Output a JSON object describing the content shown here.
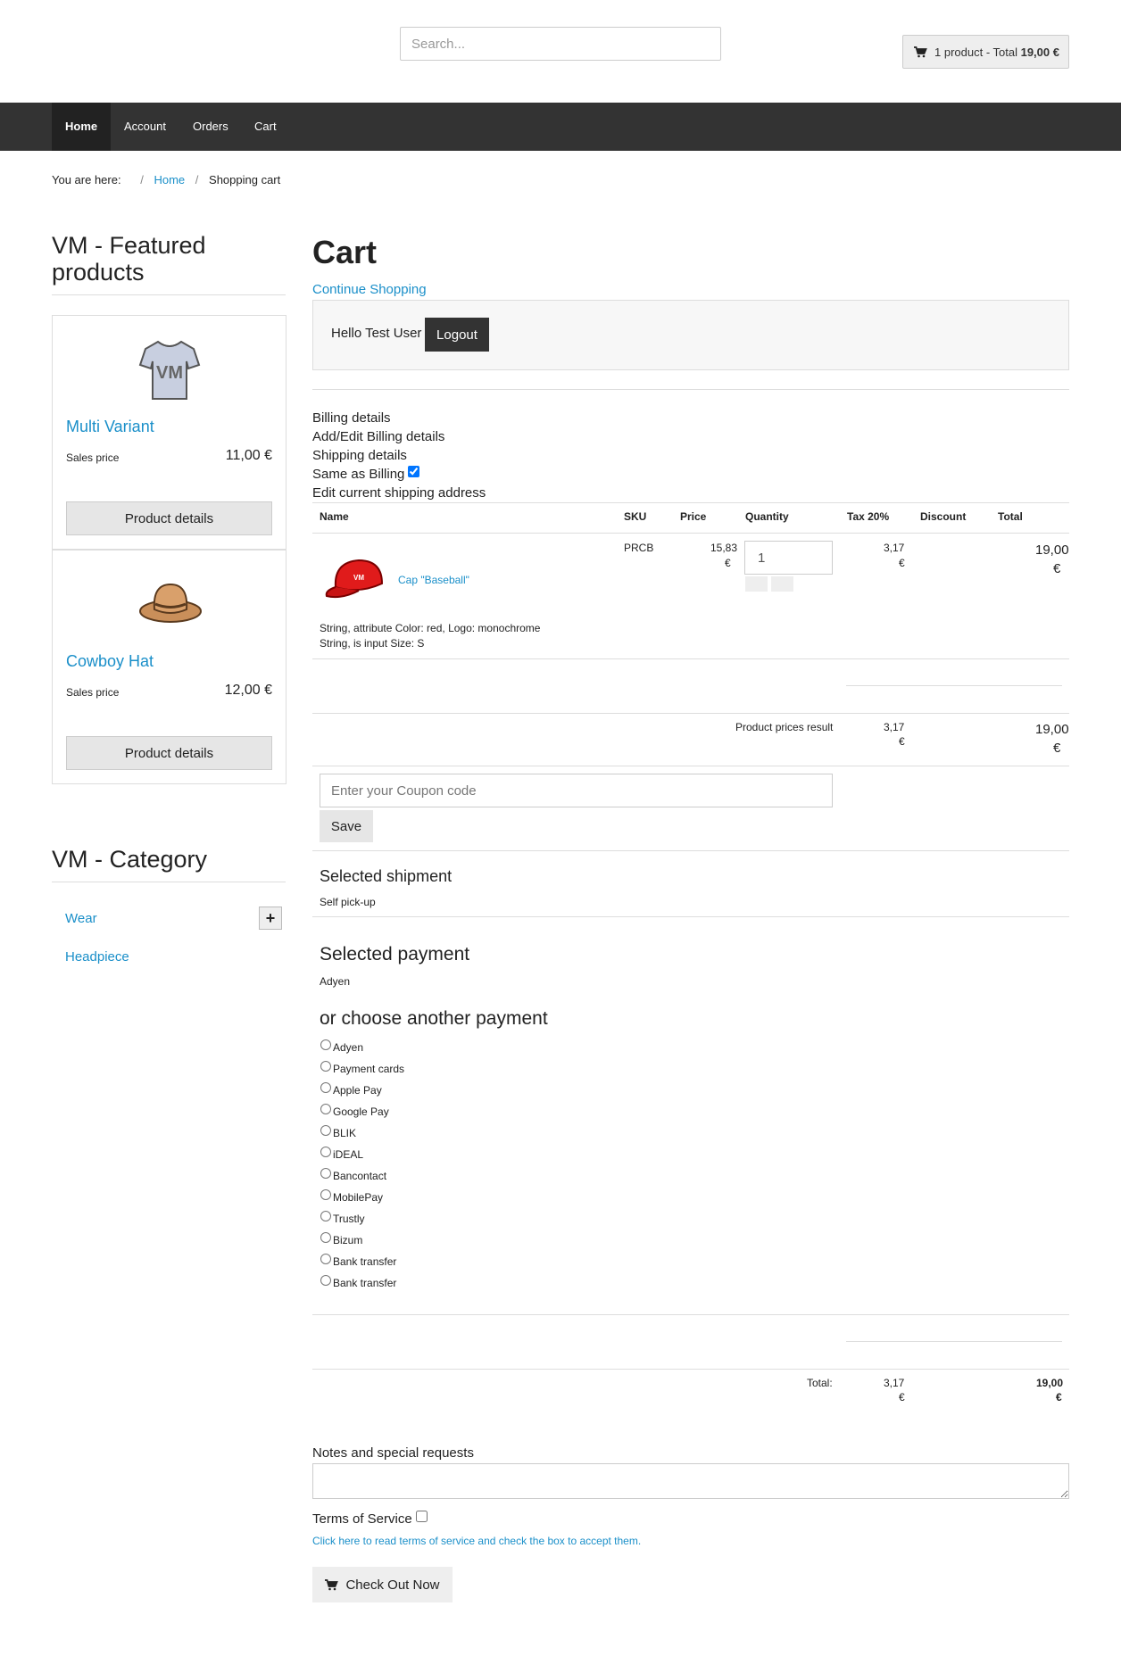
{
  "header": {
    "search_placeholder": "Search...",
    "minicart_text": "1 product - Total ",
    "minicart_total": "19,00 €"
  },
  "nav": [
    "Home",
    "Account",
    "Orders",
    "Cart"
  ],
  "breadcrumb": {
    "label": "You are here:",
    "home": "Home",
    "current": "Shopping cart"
  },
  "sidebar": {
    "featured_title": "VM - Featured products",
    "products": [
      {
        "name": "Multi Variant",
        "price_label": "Sales price",
        "price": "11,00 €",
        "button": "Product details"
      },
      {
        "name": "Cowboy Hat",
        "price_label": "Sales price",
        "price": "12,00 €",
        "button": "Product details"
      }
    ],
    "category_title": "VM - Category",
    "categories": [
      "Wear",
      "Headpiece"
    ]
  },
  "cart": {
    "title": "Cart",
    "continue": "Continue Shopping",
    "hello": "Hello Test User",
    "logout": "Logout",
    "billing_details": "Billing details",
    "edit_billing": "Add/Edit Billing details",
    "shipping_details": "Shipping details",
    "same_as_billing": "Same as Billing",
    "edit_shipping": "Edit current shipping address",
    "columns": [
      "Name",
      "SKU",
      "Price",
      "Quantity",
      "Tax 20%",
      "Discount",
      "Total"
    ],
    "item": {
      "name": "Cap \"Baseball\"",
      "sku": "PRCB",
      "price": "15,83",
      "currency": "€",
      "quantity": "1",
      "tax": "3,17",
      "total": "19,00",
      "attr1": "String, attribute Color: red, Logo: monochrome",
      "attr2": "String, is input Size: S"
    },
    "prices_result_label": "Product prices result",
    "prices_result_tax": "3,17",
    "prices_result_total": "19,00",
    "coupon_placeholder": "Enter your Coupon code",
    "save": "Save",
    "selected_shipment_title": "Selected shipment",
    "selected_shipment": "Self pick-up",
    "selected_payment_title": "Selected payment",
    "selected_payment": "Adyen",
    "choose_payment_title": "or choose another payment",
    "payments": [
      "Adyen",
      "Payment cards",
      "Apple Pay",
      "Google Pay",
      "BLIK",
      "iDEAL",
      "Bancontact",
      "MobilePay",
      "Trustly",
      "Bizum",
      "Bank transfer",
      "Bank transfer"
    ],
    "total_label": "Total:",
    "total_tax": "3,17",
    "total_value": "19,00",
    "notes_label": "Notes and special requests",
    "tos_label": "Terms of Service",
    "tos_link": "Click here to read terms of service and check the box to accept them.",
    "checkout": "Check Out Now"
  },
  "colors": {
    "nav_bg": "#333333",
    "link": "#1a8fc9",
    "cap_red": "#e01b1b"
  }
}
